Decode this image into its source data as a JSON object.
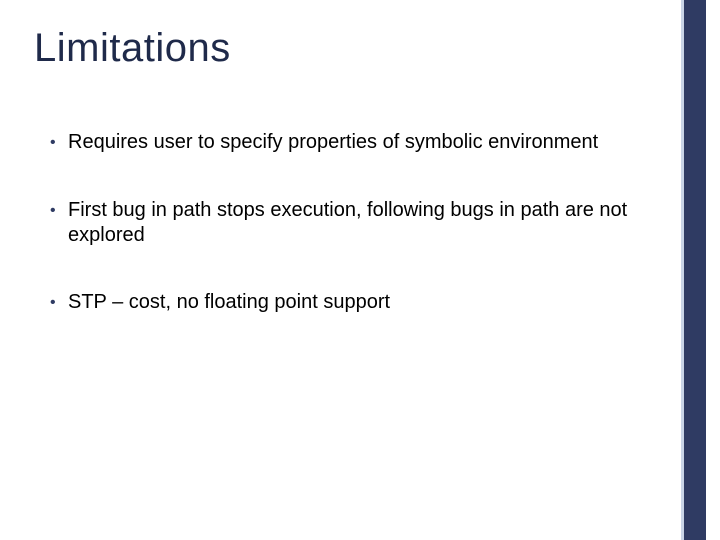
{
  "slide": {
    "title": "Limitations",
    "bullets": [
      "Requires user to specify properties of symbolic environment",
      "First bug in path stops execution, following bugs in path are not explored",
      "STP – cost, no floating point support"
    ]
  },
  "colors": {
    "accent": "#2f3b63",
    "title": "#1f2a4a"
  }
}
